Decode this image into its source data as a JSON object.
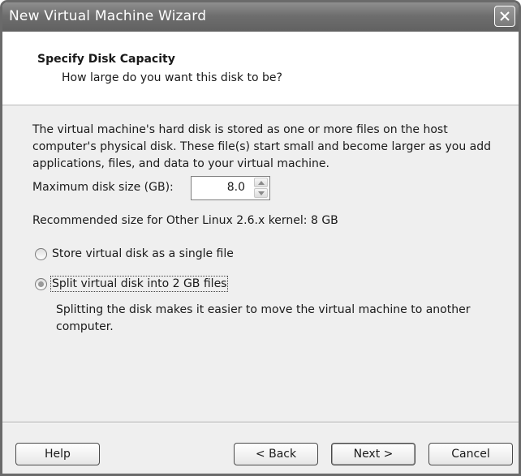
{
  "window": {
    "title": "New Virtual Machine Wizard"
  },
  "header": {
    "title": "Specify Disk Capacity",
    "subtitle": "How large do you want this disk to be?"
  },
  "content": {
    "description": "The virtual machine's hard disk is stored as one or more files on the host computer's physical disk. These file(s) start small and become larger as you add applications, files, and data to your virtual machine.",
    "disk_size": {
      "label": "Maximum disk size (GB):",
      "value": "8.0"
    },
    "recommendation": "Recommended size for Other Linux 2.6.x kernel: 8 GB",
    "options": [
      {
        "label": "Store virtual disk as a single file",
        "selected": false
      },
      {
        "label": "Split virtual disk into 2 GB files",
        "selected": true
      }
    ],
    "split_description": "Splitting the disk makes it easier to move the virtual machine to another computer."
  },
  "buttons": {
    "help": "Help",
    "back": "< Back",
    "next": "Next >",
    "cancel": "Cancel"
  },
  "icons": {
    "close": "close-icon",
    "spin_up": "spin-up-arrow-icon",
    "spin_down": "spin-down-arrow-icon"
  }
}
